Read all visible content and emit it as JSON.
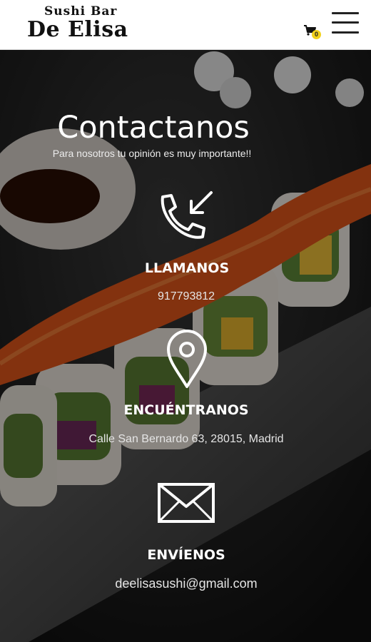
{
  "header": {
    "logo_top": "Sushi Bar",
    "logo_main": "De Elisa",
    "cart_count": "0",
    "cart_icon": "cart-icon",
    "menu_icon": "hamburger-menu-icon"
  },
  "hero": {
    "title": "Contactanos",
    "subtitle": "Para nosotros tu opinión es muy importante!!"
  },
  "contact": {
    "phone": {
      "icon": "phone-incoming-icon",
      "label": "LLAMANOS",
      "value": "917793812"
    },
    "location": {
      "icon": "map-pin-icon",
      "label": "ENCUÉNTRANOS",
      "value": "Calle San Bernardo 63, 28015, Madrid"
    },
    "email": {
      "icon": "envelope-icon",
      "label": "ENVÍENOS",
      "value": "deelisasushi@gmail.com"
    }
  },
  "colors": {
    "header_bg": "#ffffff",
    "badge": "#f2d11a",
    "text": "#ffffff"
  }
}
